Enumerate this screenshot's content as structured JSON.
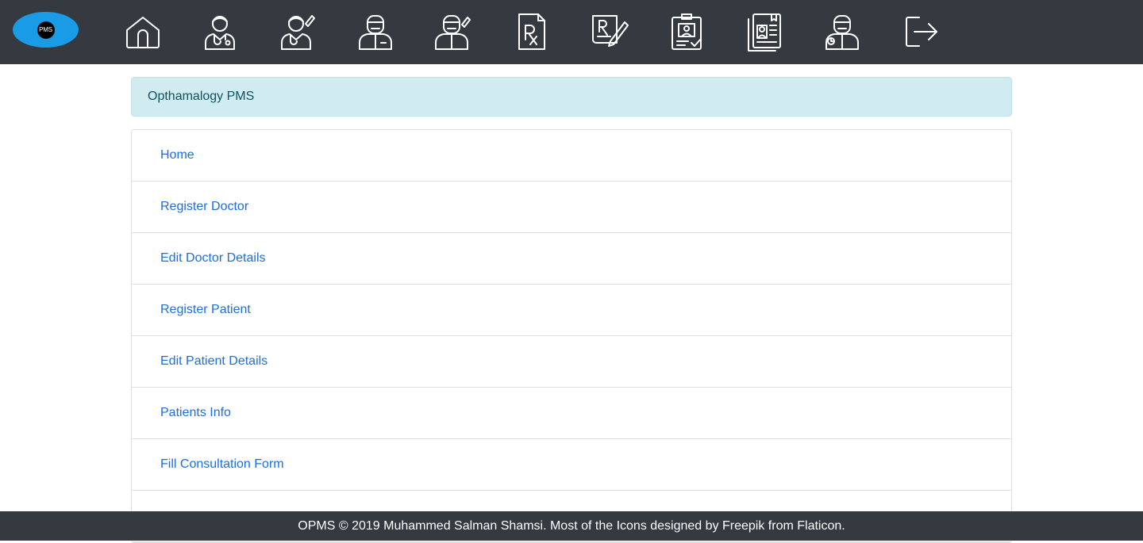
{
  "logo": {
    "text": "PMS"
  },
  "nav": {
    "icons": [
      "home-icon",
      "doctor-stethoscope-icon",
      "doctor-edit-icon",
      "patient-icon",
      "patient-edit-icon",
      "prescription-icon",
      "prescription-write-icon",
      "id-card-check-icon",
      "patient-records-icon",
      "patient-history-icon",
      "logout-icon"
    ]
  },
  "alert": {
    "title": "Opthamalogy PMS"
  },
  "menu": {
    "items": [
      {
        "label": "Home"
      },
      {
        "label": "Register Doctor"
      },
      {
        "label": "Edit Doctor Details"
      },
      {
        "label": "Register Patient"
      },
      {
        "label": "Edit Patient Details"
      },
      {
        "label": "Patients Info"
      },
      {
        "label": "Fill Consultation Form"
      }
    ]
  },
  "footer": {
    "text": "OPMS © 2019 Muhammed Salman Shamsi. Most of the Icons designed by Freepik from Flaticon."
  },
  "colors": {
    "navbar": "#343a40",
    "alert_bg": "#d1ecf1",
    "alert_text": "#0c5460",
    "link": "#1a6fe0",
    "logo": "#1a9be6"
  }
}
